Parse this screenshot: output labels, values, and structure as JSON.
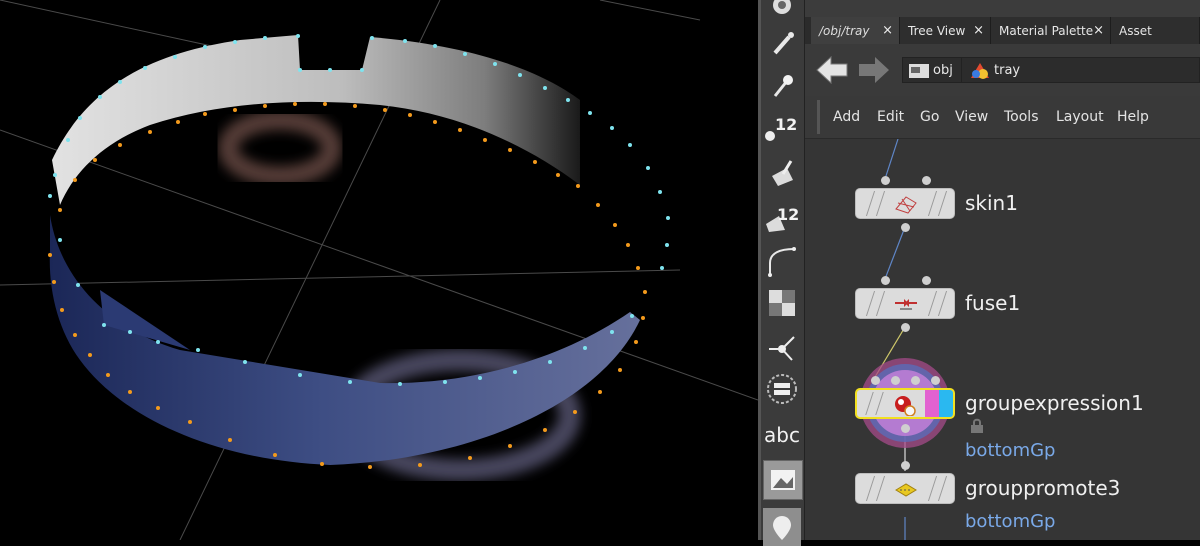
{
  "tabs": [
    {
      "label": "/obj/tray",
      "close": "×"
    },
    {
      "label": "Tree View",
      "close": "×"
    },
    {
      "label": "Material Palette",
      "close": "×"
    },
    {
      "label": "Asset Browser",
      "close": ""
    }
  ],
  "path": {
    "root": "obj",
    "current": "tray"
  },
  "menu": [
    "Add",
    "Edit",
    "Go",
    "View",
    "Tools",
    "Layout",
    "Help"
  ],
  "shelf": {
    "poly_num": "12",
    "face_num": "12",
    "text_tool": "abc"
  },
  "nodes": [
    {
      "name": "skin1",
      "icon": "skin-icon"
    },
    {
      "name": "fuse1",
      "icon": "fuse-icon"
    },
    {
      "name": "groupexpression1",
      "icon": "groupexpression-icon",
      "group": "bottomGp",
      "selected": true
    },
    {
      "name": "grouppromote3",
      "icon": "grouppromote-icon",
      "group": "bottomGp"
    }
  ],
  "colors": {
    "selected_node_border": "#f2e020",
    "group_label": "#7aa9e8",
    "wire_blue": "#5f86c7",
    "wire_yellow": "#cfc86a"
  }
}
